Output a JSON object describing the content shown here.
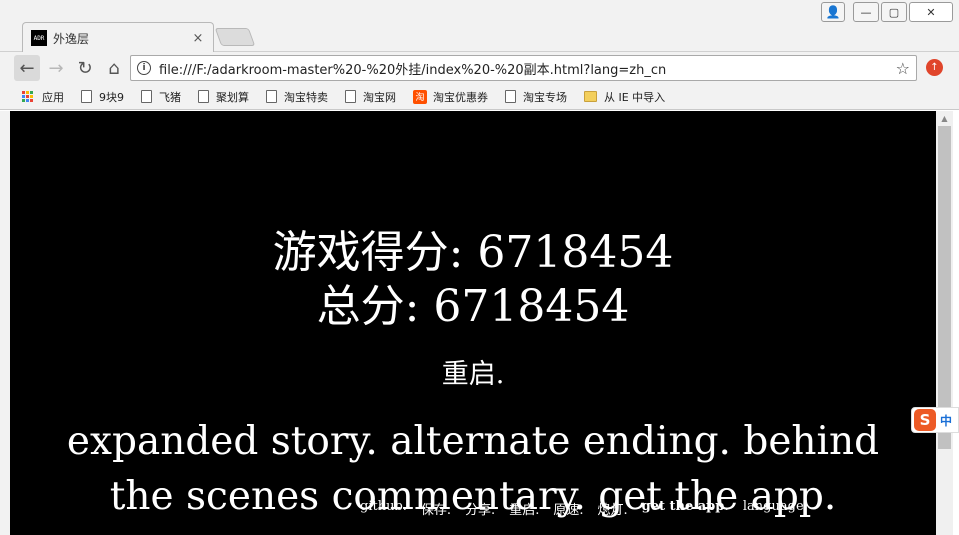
{
  "browser": {
    "tab": {
      "favicon_text": "ADR",
      "title": "外逸层",
      "close": "×"
    },
    "window_buttons": {
      "profile": "👤",
      "minimize": "—",
      "maximize": "▢",
      "close": "✕"
    },
    "toolbar": {
      "back": "←",
      "forward": "→",
      "reload": "↻",
      "home": "⌂",
      "info": "i",
      "url": "file:///F:/adarkroom-master%20-%20外挂/index%20-%20副本.html?lang=zh_cn",
      "star": "☆",
      "extension": "↑"
    },
    "bookmarks": [
      {
        "label": "应用",
        "icon": "apps-icon"
      },
      {
        "label": "9块9",
        "icon": "page-icon"
      },
      {
        "label": "飞猪",
        "icon": "page-icon"
      },
      {
        "label": "聚划算",
        "icon": "page-icon"
      },
      {
        "label": "淘宝特卖",
        "icon": "page-icon"
      },
      {
        "label": "淘宝网",
        "icon": "page-icon"
      },
      {
        "label": "淘宝优惠券",
        "icon": "taobao-icon",
        "icon_text": "淘"
      },
      {
        "label": "淘宝专场",
        "icon": "page-icon"
      },
      {
        "label": "从 IE 中导入",
        "icon": "folder-icon"
      }
    ]
  },
  "game": {
    "score_line": "游戏得分: 6718454",
    "total_line": "总分: 6718454",
    "restart": "重启.",
    "promo": "expanded story. alternate ending. behind the scenes commentary. get the app.",
    "footer": [
      "github.",
      "保存.",
      "分享.",
      "重启.",
      "原速.",
      "熄灯.",
      "get the app.",
      "language."
    ]
  },
  "ime": {
    "logo": "S",
    "text": "中"
  },
  "scrollbar": {
    "up": "▲"
  }
}
